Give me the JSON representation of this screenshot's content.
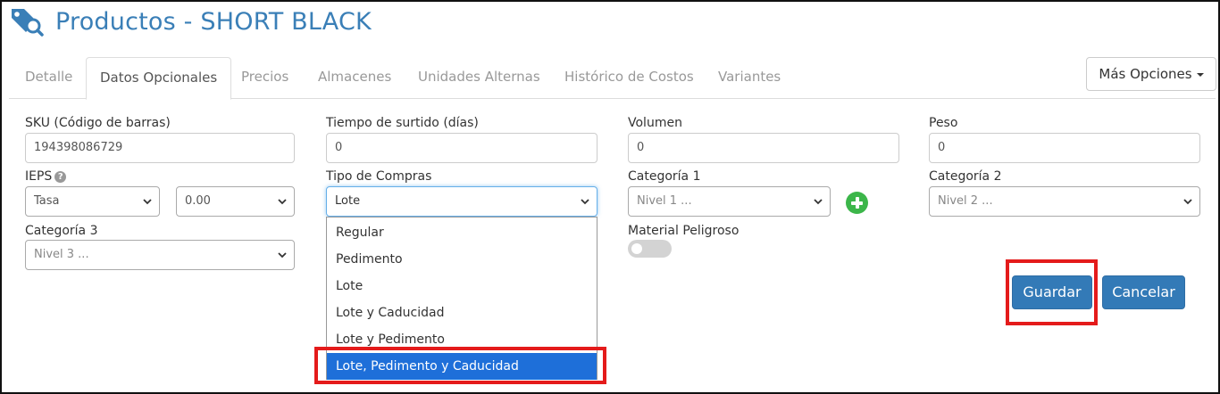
{
  "page": {
    "title": "Productos - SHORT BLACK",
    "icon": "tag-search-icon"
  },
  "tabs": [
    {
      "label": "Detalle",
      "active": false
    },
    {
      "label": "Datos Opcionales",
      "active": true
    },
    {
      "label": "Precios",
      "active": false
    },
    {
      "label": "Almacenes",
      "active": false
    },
    {
      "label": "Unidades Alternas",
      "active": false
    },
    {
      "label": "Histórico de Costos",
      "active": false
    },
    {
      "label": "Variantes",
      "active": false
    }
  ],
  "more_options": {
    "label": "Más Opciones"
  },
  "form": {
    "sku": {
      "label": "SKU (Código de barras)",
      "value": "194398086729"
    },
    "tiempo": {
      "label": "Tiempo de surtido (días)",
      "value": "0"
    },
    "volumen": {
      "label": "Volumen",
      "value": "0"
    },
    "peso": {
      "label": "Peso",
      "value": "0"
    },
    "ieps": {
      "label": "IEPS",
      "type_value": "Tasa",
      "amount_value": "0.00"
    },
    "tipo_compras": {
      "label": "Tipo de Compras",
      "value": "Lote",
      "options": [
        "Regular",
        "Pedimento",
        "Lote",
        "Lote y Caducidad",
        "Lote y Pedimento",
        "Lote, Pedimento y Caducidad"
      ],
      "highlighted": "Lote, Pedimento y Caducidad"
    },
    "categoria1": {
      "label": "Categoría 1",
      "value": "Nivel 1 ..."
    },
    "categoria2": {
      "label": "Categoría 2",
      "value": "Nivel 2 ..."
    },
    "categoria3": {
      "label": "Categoría 3",
      "value": "Nivel 3 ..."
    },
    "material_peligroso": {
      "label": "Material Peligroso",
      "checked": false
    }
  },
  "actions": {
    "save": "Guardar",
    "cancel": "Cancelar"
  },
  "colors": {
    "accent": "#337ab7",
    "title": "#3a7fb7",
    "highlight": "#e41b1b",
    "add": "#3cb64a",
    "selected_option": "#1e6fd9"
  }
}
